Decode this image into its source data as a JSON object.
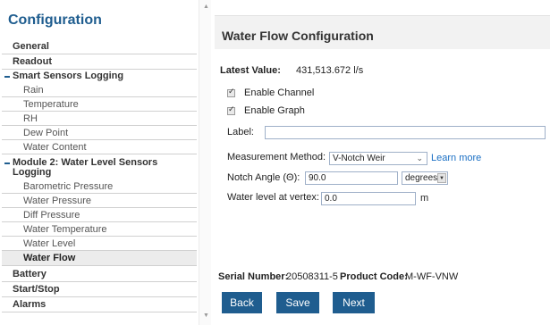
{
  "sidebar": {
    "title": "Configuration",
    "items": [
      {
        "label": "General"
      },
      {
        "label": "Readout"
      },
      {
        "label": "Smart Sensors Logging"
      },
      {
        "label": "Rain"
      },
      {
        "label": "Temperature"
      },
      {
        "label": "RH"
      },
      {
        "label": "Dew Point"
      },
      {
        "label": "Water Content"
      },
      {
        "label": "Module 2: Water Level Sensors Logging"
      },
      {
        "label": "Barometric Pressure"
      },
      {
        "label": "Water Pressure"
      },
      {
        "label": "Diff Pressure"
      },
      {
        "label": "Water Temperature"
      },
      {
        "label": "Water Level"
      },
      {
        "label": "Water Flow"
      },
      {
        "label": "Battery"
      },
      {
        "label": "Start/Stop"
      },
      {
        "label": "Alarms"
      }
    ]
  },
  "main": {
    "title": "Water Flow Configuration",
    "latest_value_label": "Latest Value:",
    "latest_value": "431,513.672 l/s",
    "enable_channel_label": "Enable Channel",
    "enable_graph_label": "Enable Graph",
    "label_field_label": "Label:",
    "label_field_value": "",
    "measurement_method_label": "Measurement Method:",
    "measurement_method_value": "V-Notch Weir",
    "learn_more": "Learn more",
    "notch_angle_label": "Notch Angle (Θ):",
    "notch_angle_value": "90.0",
    "notch_angle_unit": "degrees",
    "water_level_label": "Water level at vertex:",
    "water_level_value": "0.0",
    "water_level_unit": "m",
    "serial_label": "Serial Number:",
    "serial_value": "20508311-5",
    "product_label": "Product Code:",
    "product_value": "M-WF-VNW",
    "buttons": {
      "back": "Back",
      "save": "Save",
      "next": "Next"
    }
  },
  "colors": {
    "accent": "#1f5d8f",
    "link": "#1a6fc4"
  }
}
